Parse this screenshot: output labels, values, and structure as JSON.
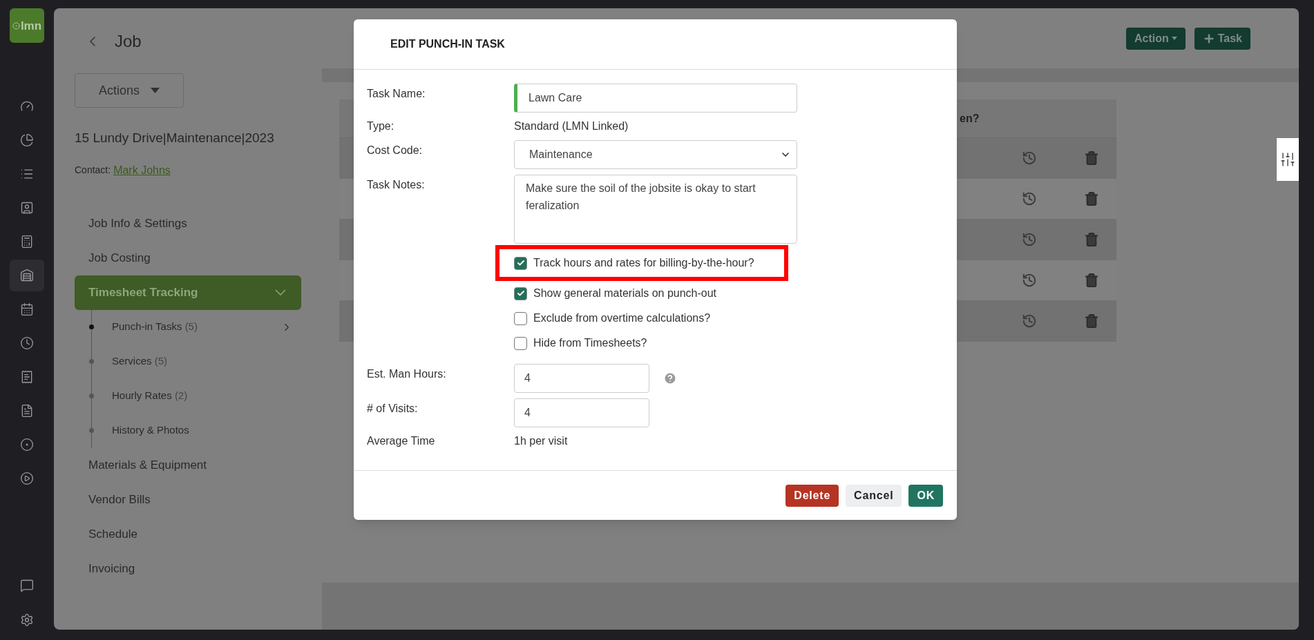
{
  "rail": {
    "logo": "lmn",
    "items": [
      {
        "selected": false
      },
      {
        "selected": false
      },
      {
        "selected": false
      },
      {
        "selected": false
      },
      {
        "selected": false
      },
      {
        "selected": true
      },
      {
        "selected": false
      },
      {
        "selected": false
      },
      {
        "selected": false
      },
      {
        "selected": false
      },
      {
        "selected": false
      },
      {
        "selected": false
      }
    ],
    "bottom_items": [
      {
        "selected": false
      },
      {
        "selected": false
      }
    ]
  },
  "job_panel": {
    "title": "Job",
    "actions_button": "Actions",
    "job_name": "15 Lundy Drive|Maintenance|2023",
    "contact_label": "Contact:",
    "contact_name": "Mark Johns",
    "nav": [
      {
        "label": "Job Info & Settings",
        "selected": false
      },
      {
        "label": "Job Costing",
        "selected": false
      },
      {
        "label": "Timesheet Tracking",
        "selected": true,
        "expanded": true,
        "children": [
          {
            "label": "Punch-in Tasks",
            "count": "(5)",
            "selected": true
          },
          {
            "label": "Services",
            "count": "(5)",
            "selected": false
          },
          {
            "label": "Hourly Rates",
            "count": "(2)",
            "selected": false
          },
          {
            "label": "History & Photos",
            "selected": false
          }
        ]
      },
      {
        "label": "Materials & Equipment",
        "selected": false
      },
      {
        "label": "Vendor Bills",
        "selected": false
      },
      {
        "label": "Schedule",
        "selected": false
      },
      {
        "label": "Invoicing",
        "selected": false
      }
    ]
  },
  "toolbar": {
    "buttons": [
      {
        "label": "Action",
        "kind": "dropdown"
      },
      {
        "label": "Task",
        "kind": "add"
      }
    ]
  },
  "table": {
    "column_header": "en?",
    "rows": [
      {
        "shaded": true
      },
      {
        "shaded": false
      },
      {
        "shaded": true
      },
      {
        "shaded": false
      },
      {
        "shaded": true
      }
    ]
  },
  "dialog": {
    "title": "EDIT PUNCH-IN TASK",
    "fields": [
      {
        "label": "Task Name:",
        "kind": "input",
        "value": "Lawn Care",
        "accent": true
      },
      {
        "label": "Type:",
        "kind": "text",
        "value": "Standard (LMN Linked)"
      },
      {
        "label": "Cost Code:",
        "kind": "select",
        "value": "Maintenance"
      },
      {
        "label": "Task Notes:",
        "kind": "textarea",
        "value": "Make sure the soil of the jobsite is okay to start feralization"
      }
    ],
    "options": [
      {
        "label": "Track hours and rates for billing-by-the-hour?",
        "checked": true,
        "highlighted": true
      },
      {
        "label": "Show general materials on punch-out",
        "checked": true,
        "highlighted": false
      },
      {
        "label": "Exclude from overtime calculations?",
        "checked": false,
        "highlighted": false
      },
      {
        "label": "Hide from Timesheets?",
        "checked": false,
        "highlighted": false
      }
    ],
    "more_fields": [
      {
        "label": "Est. Man Hours:",
        "kind": "input",
        "value": "4",
        "help": true
      },
      {
        "label": "# of Visits:",
        "kind": "input",
        "value": "4",
        "help": false
      },
      {
        "label": "Average Time",
        "kind": "text",
        "value": "1h per visit"
      }
    ],
    "buttons": [
      {
        "label": "Delete",
        "kind": "danger"
      },
      {
        "label": "Cancel",
        "kind": "secondary"
      },
      {
        "label": "OK",
        "kind": "primary"
      }
    ]
  }
}
